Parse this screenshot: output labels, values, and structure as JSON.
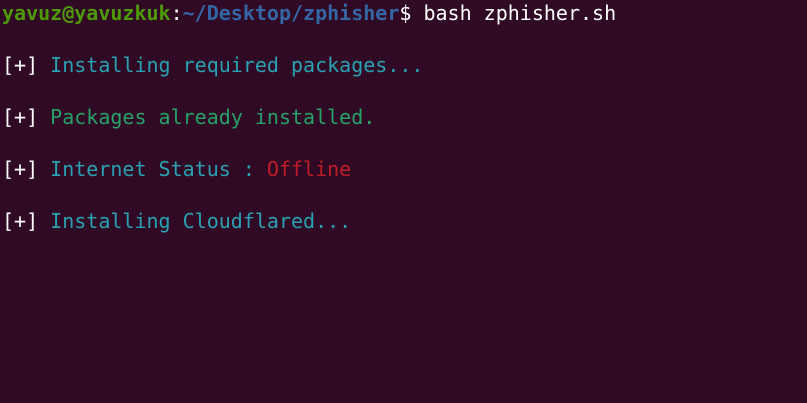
{
  "prompt": {
    "user_host": "yavuz@yavuzkuk",
    "separator": ":",
    "path": "~/Desktop/zphisher",
    "symbol": "$ ",
    "command": "bash zphisher.sh"
  },
  "output": {
    "line1": {
      "prefix": "[+]",
      "text": " Installing required packages..."
    },
    "line2": {
      "prefix": "[+]",
      "text": " Packages already installed."
    },
    "line3": {
      "prefix": "[+]",
      "text": " Internet Status : ",
      "status": "Offline"
    },
    "line4": {
      "prefix": "[+]",
      "text": " Installing Cloudflared..."
    }
  },
  "colors": {
    "background": "#300a24",
    "user_host": "#4e9a06",
    "path": "#3465a4",
    "cyan": "#2aa1b3",
    "green": "#26a269",
    "red": "#c01c28"
  }
}
